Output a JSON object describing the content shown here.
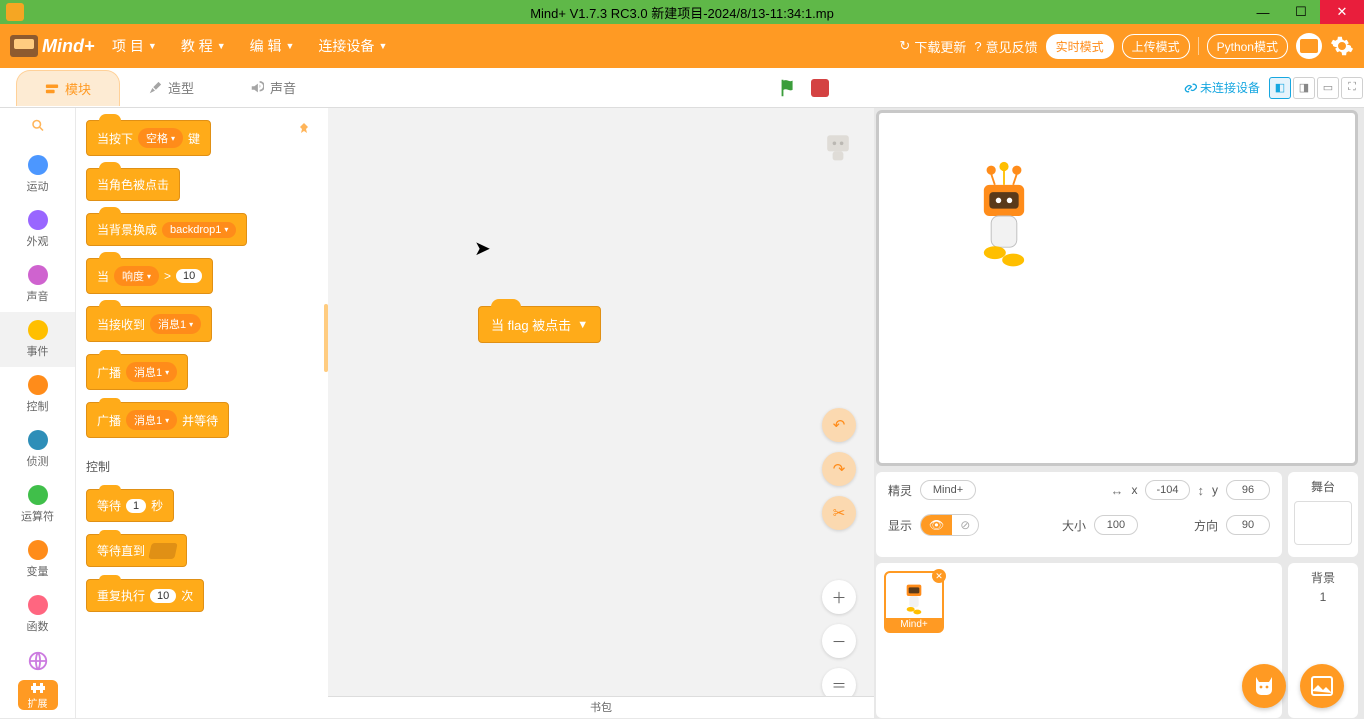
{
  "title": "Mind+ V1.7.3 RC3.0   新建项目-2024/8/13-11:34:1.mp",
  "logo": "Mind+",
  "menus": {
    "project": "项 目",
    "tutorial": "教 程",
    "edit": "编 辑",
    "connect": "连接设备"
  },
  "links": {
    "download": "下载更新",
    "feedback": "意见反馈"
  },
  "modes": {
    "realtime": "实时模式",
    "upload": "上传模式",
    "python": "Python模式"
  },
  "tabs": {
    "blocks": "模块",
    "costume": "造型",
    "sound": "声音"
  },
  "device_status": "未连接设备",
  "categories": {
    "motion": "运动",
    "looks": "外观",
    "sound": "声音",
    "events": "事件",
    "control": "控制",
    "sensing": "侦测",
    "operators": "运算符",
    "variables": "变量",
    "functions": "函数"
  },
  "category_colors": {
    "motion": "#4c97ff",
    "looks": "#9966ff",
    "sound": "#cf63cf",
    "events": "#ffbf00",
    "control": "#ff8c1a",
    "sensing": "#2e8eb8",
    "operators": "#40bf4a",
    "variables": "#ff8c1a",
    "functions": "#ff6680"
  },
  "ext_label": "扩展",
  "section_control_label": "控制",
  "blocks": {
    "when_key": {
      "pre": "当按下",
      "field": "空格",
      "post": "键"
    },
    "when_sprite_clicked": "当角色被点击",
    "when_backdrop": {
      "pre": "当背景换成",
      "field": "backdrop1"
    },
    "when_gt": {
      "pre": "当",
      "field": "响度",
      "op": ">",
      "val": "10"
    },
    "when_receive": {
      "pre": "当接收到",
      "field": "消息1"
    },
    "broadcast": {
      "pre": "广播",
      "field": "消息1"
    },
    "broadcast_wait": {
      "pre": "广播",
      "field": "消息1",
      "post": "并等待"
    },
    "wait": {
      "pre": "等待",
      "val": "1",
      "post": "秒"
    },
    "wait_until": "等待直到",
    "repeat": {
      "pre": "重复执行",
      "val": "10",
      "post": "次"
    },
    "workspace_block": "当 flag 被点击"
  },
  "backpack": "书包",
  "sprite_panel": {
    "sprite_label": "精灵",
    "sprite_name": "Mind+",
    "x_label": "x",
    "x_val": "-104",
    "y_label": "y",
    "y_val": "96",
    "show_label": "显示",
    "size_label": "大小",
    "size_val": "100",
    "dir_label": "方向",
    "dir_val": "90",
    "stage_label": "舞台",
    "backdrop_label": "背景",
    "backdrop_count": "1"
  },
  "sprite_card_name": "Mind+"
}
